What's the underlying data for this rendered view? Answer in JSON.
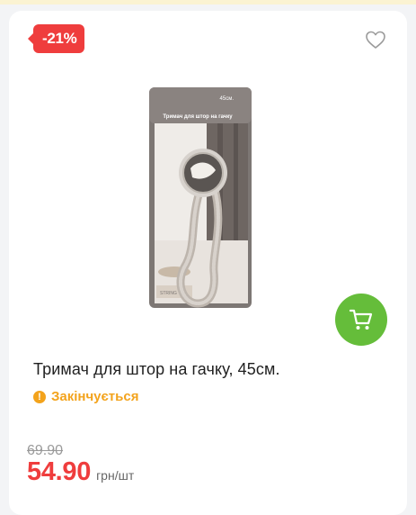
{
  "badge": {
    "discount": "-21%"
  },
  "product": {
    "title": "Тримач для штор на гачку, 45см.",
    "status": "Закінчується",
    "packaging_text": {
      "size": "45см.",
      "name": "Тримач для штор на гачку",
      "tag": "STRING"
    }
  },
  "price": {
    "old": "69.90",
    "current": "54.90",
    "unit": "грн/шт"
  },
  "icons": {
    "wishlist": "heart-outline-icon",
    "cart": "shopping-cart-icon",
    "status": "exclamation-circle-icon"
  },
  "colors": {
    "discount": "#ef3d3d",
    "cart": "#65bd3a",
    "warning": "#f3a31c"
  }
}
